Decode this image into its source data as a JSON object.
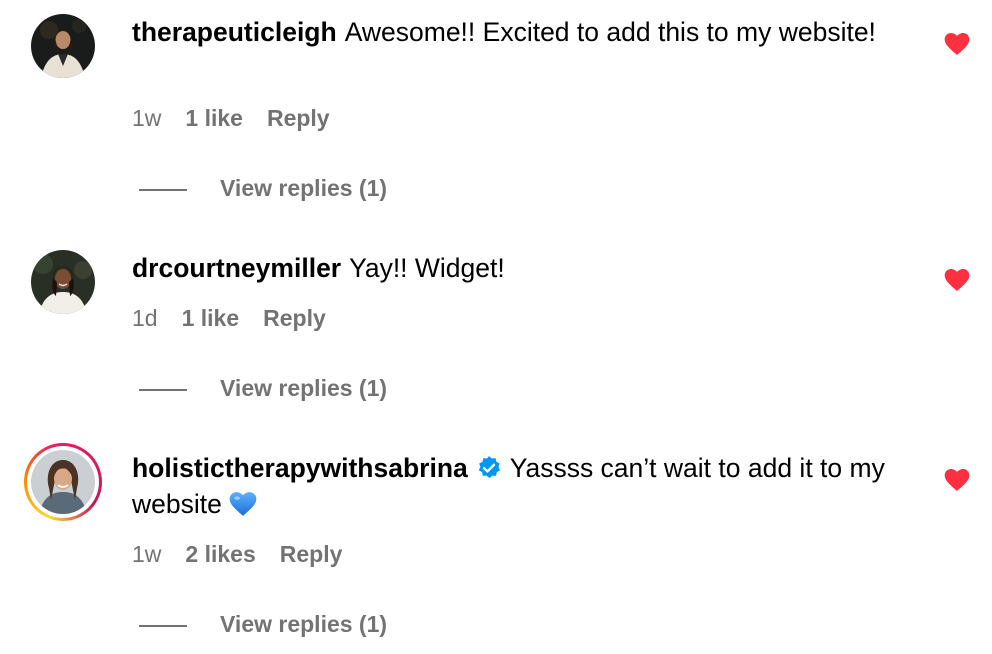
{
  "comments": [
    {
      "username": "therapeuticleigh",
      "text": "Awesome!! Excited to add this to my website!",
      "time": "1w",
      "likes": "1 like",
      "reply_label": "Reply",
      "view_replies": "View replies (1)",
      "liked": true,
      "verified": false,
      "has_story_ring": false
    },
    {
      "username": "drcourtneymiller",
      "text": "Yay!! Widget!",
      "time": "1d",
      "likes": "1 like",
      "reply_label": "Reply",
      "view_replies": "View replies (1)",
      "liked": true,
      "verified": false,
      "has_story_ring": false
    },
    {
      "username": "holistictherapywithsabrina",
      "text": "Yassss can’t wait to add it to my website",
      "emoji": "blue-heart",
      "time": "1w",
      "likes": "2 likes",
      "reply_label": "Reply",
      "view_replies": "View replies (1)",
      "liked": true,
      "verified": true,
      "has_story_ring": true
    }
  ],
  "colors": {
    "like_red": "#ff3040",
    "meta_gray": "#737373",
    "verified_blue": "#0095f6",
    "emoji_blue": "#2a8cf0"
  },
  "icons": {
    "like": "heart-icon",
    "verified": "verified-badge-icon",
    "emoji": "blue-heart-emoji-icon"
  }
}
